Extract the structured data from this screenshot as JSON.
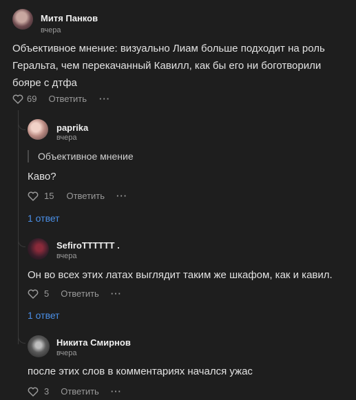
{
  "comments": [
    {
      "author": "Митя Панков",
      "time": "вчера",
      "text_lines": [
        "Объективное мнение: визуально Лиам больше подходит на роль",
        "Геральта, чем перекачанный Кавилл, как бы его ни боготворили",
        "бояре с дтфа"
      ],
      "likes": "69",
      "reply_label": "Ответить",
      "more": "···"
    },
    {
      "author": "paprika",
      "time": "вчера",
      "quote": "Объективное мнение",
      "text": "Каво?",
      "likes": "15",
      "reply_label": "Ответить",
      "more": "···",
      "replies_link": "1 ответ"
    },
    {
      "author": "SefiroTTTTTT .",
      "time": "вчера",
      "text": "Он во всех этих латах выглядит таким же шкафом, как и кавил.",
      "likes": "5",
      "reply_label": "Ответить",
      "more": "···",
      "replies_link": "1 ответ"
    },
    {
      "author": "Никита Смирнов",
      "time": "вчера",
      "text": "после этих слов в комментариях начался ужас",
      "likes": "3",
      "reply_label": "Ответить",
      "more": "···"
    }
  ],
  "colors": {
    "background": "#1e1e1e",
    "link": "#4a8fe7",
    "muted": "#9a9a9a",
    "thread_line": "#3a3a3a"
  }
}
